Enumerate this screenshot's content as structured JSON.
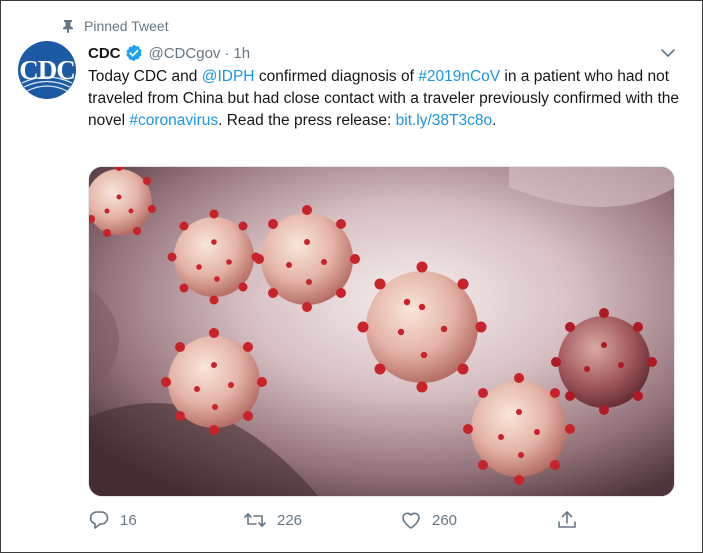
{
  "pinned_label": "Pinned Tweet",
  "author": {
    "name": "CDC",
    "handle": "@CDCgov",
    "time": "1h",
    "avatar_text": "CDC"
  },
  "tweet": {
    "segments": [
      {
        "text": "Today CDC and ",
        "link": false
      },
      {
        "text": "@IDPH",
        "link": true
      },
      {
        "text": " confirmed diagnosis of ",
        "link": false
      },
      {
        "text": "#2019nCoV",
        "link": true
      },
      {
        "text": " in a patient who had not traveled from China but had close contact with a traveler previously confirmed with the novel ",
        "link": false
      },
      {
        "text": "#coronavirus",
        "link": true
      },
      {
        "text": ". Read the press release: ",
        "link": false
      },
      {
        "text": "bit.ly/38T3c8o",
        "link": true
      },
      {
        "text": ".",
        "link": false
      }
    ]
  },
  "actions": {
    "reply_count": "16",
    "retweet_count": "226",
    "like_count": "260"
  },
  "colors": {
    "link": "#1b95e0",
    "secondary": "#657786",
    "verified": "#1da1f2",
    "avatar": "#1c5aa6",
    "virus": "#c8222a"
  },
  "icons": [
    "pin-icon",
    "verified-badge-icon",
    "chevron-down-icon",
    "reply-icon",
    "retweet-icon",
    "like-icon",
    "share-icon"
  ]
}
